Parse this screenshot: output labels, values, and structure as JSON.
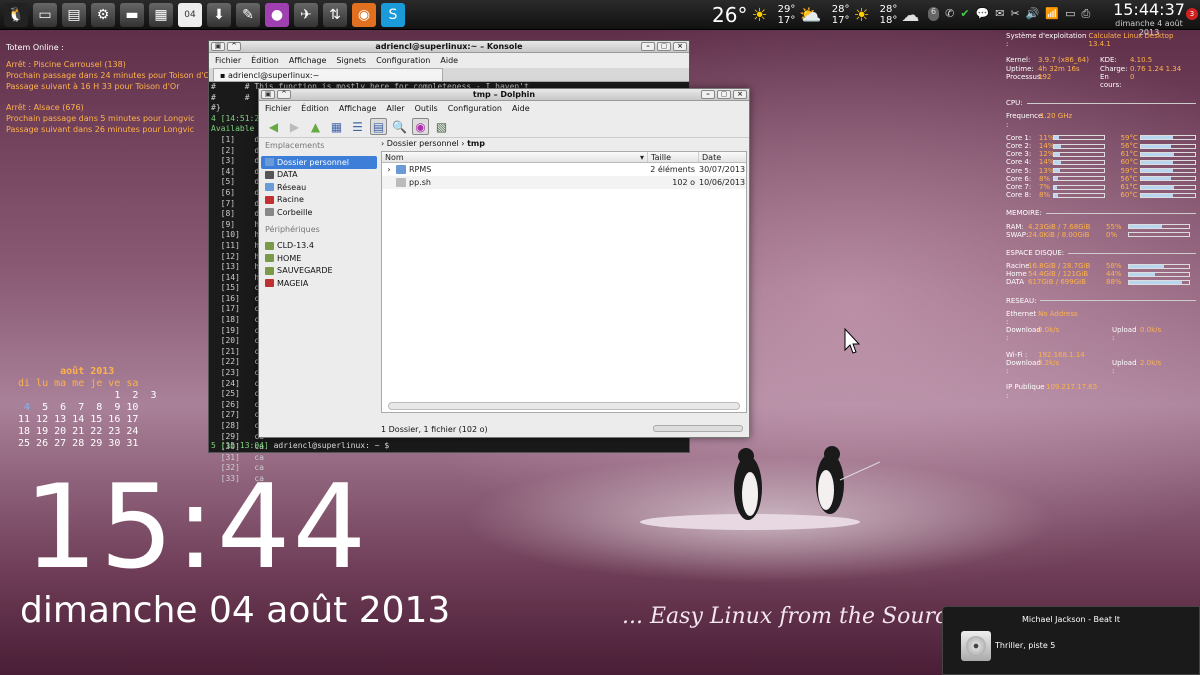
{
  "panel": {
    "launchers": [
      "tux-icon",
      "desktop-icon",
      "server-icon",
      "gear-icon",
      "monitor-icon",
      "calculator-icon",
      "calendar-icon",
      "download-icon",
      "notes-icon",
      "chat-icon",
      "bird-icon",
      "network-icon",
      "firefox-icon",
      "skype-icon"
    ],
    "calendar_day": "04",
    "weather": {
      "now_temp": "26°",
      "d1_high": "29°",
      "d1_low": "17°",
      "d2_high": "28°",
      "d2_low": "17°",
      "d3_high": "28°",
      "d3_low": "18°"
    },
    "tray_badge": "6",
    "clock_time": "15:44:37",
    "clock_date": "dimanche 4 août 2013",
    "notif_count": "3"
  },
  "totem": {
    "title": "Totem Online :",
    "stop1": "Arrêt : Piscine Carrousel  (138)",
    "stop1_l1": "Prochain passage dans 24 minutes pour Toison d'Or",
    "stop1_l2": "Passage suivant à 16 H 33 pour Toison d'Or",
    "stop2": "Arrêt : Alsace  (676)",
    "stop2_l1": "Prochain passage dans 5 minutes pour Longvic",
    "stop2_l2": "Passage suivant dans 26 minutes pour Longvic"
  },
  "calendar": {
    "month": "août 2013",
    "weekdays": "di lu ma me je ve sa",
    "row1": "                1  2  3",
    "row2a": " ",
    "today": "4",
    "row2b": "  5  6  7  8  9 10",
    "row3": "11 12 13 14 15 16 17",
    "row4": "18 19 20 21 22 23 24",
    "row5": "25 26 27 28 29 30 31"
  },
  "desktop": {
    "big_time": "15:44",
    "big_date": "dimanche 04 août 2013",
    "slogan": "... Easy Linux from the Source"
  },
  "sysmon": {
    "os_label": "Système d'exploitation :",
    "os_value": "Calculate Linux Desktop 13.4.1",
    "kernel_l": "Kernel:",
    "kernel_v": "3.9.7 (x86_64)",
    "kde_l": "KDE:",
    "kde_v": "4.10.5",
    "uptime_l": "Uptime:",
    "uptime_v": "4h 32m 16s",
    "charge_l": "Charge:",
    "charge_v": "0.76 1.24 1.34",
    "proc_l": "Processus:",
    "proc_v": "192",
    "encours_l": "En cours:",
    "encours_v": "0",
    "cpu_title": "CPU:",
    "freq_l": "Frequence :",
    "freq_v": "1.20 GHz",
    "cores": [
      {
        "name": "Core 1:",
        "pct": "11%",
        "fill": 0.11,
        "temp": "59°C",
        "tfill": 0.59
      },
      {
        "name": "Core 2:",
        "pct": "14%",
        "fill": 0.14,
        "temp": "56°C",
        "tfill": 0.56
      },
      {
        "name": "Core 3:",
        "pct": "12%",
        "fill": 0.12,
        "temp": "61°C",
        "tfill": 0.61
      },
      {
        "name": "Core 4:",
        "pct": "14%",
        "fill": 0.14,
        "temp": "60°C",
        "tfill": 0.6
      },
      {
        "name": "Core 5:",
        "pct": "13%",
        "fill": 0.13,
        "temp": "59°C",
        "tfill": 0.59
      },
      {
        "name": "Core 6:",
        "pct": "8%",
        "fill": 0.08,
        "temp": "56°C",
        "tfill": 0.56
      },
      {
        "name": "Core 7:",
        "pct": "7%",
        "fill": 0.07,
        "temp": "61°C",
        "tfill": 0.61
      },
      {
        "name": "Core 8:",
        "pct": "8%",
        "fill": 0.08,
        "temp": "60°C",
        "tfill": 0.6
      }
    ],
    "mem_title": "MEMOIRE:",
    "ram_l": "RAM:",
    "ram_v": "4.23GiB / 7.68GiB",
    "ram_p": "55%",
    "ram_f": 0.55,
    "swap_l": "SWAP:",
    "swap_v": "24.0KiB / 8.00GiB",
    "swap_p": "0%",
    "swap_f": 0.0,
    "disk_title": "ESPACE DISQUE:",
    "disks": [
      {
        "name": "Racine",
        "v": "16.8GiB / 28.7GiB",
        "p": "58%",
        "f": 0.58
      },
      {
        "name": "Home",
        "v": "54.4GiB / 121GiB",
        "p": "44%",
        "f": 0.44
      },
      {
        "name": "DATA",
        "v": "617GiB / 699GiB",
        "p": "88%",
        "f": 0.88
      }
    ],
    "net_title": "RESEAU:",
    "eth_l": "Ethernet :",
    "eth_v": "No Address",
    "eth_dl_l": "Download :",
    "eth_dl_v": "0.0k/s",
    "eth_ul_l": "Upload :",
    "eth_ul_v": "0.0k/s",
    "wifi_l": "Wi-Fi :",
    "wifi_v": "192.168.1.14",
    "wifi_dl_l": "Download :",
    "wifi_dl_v": "3.2k/s",
    "wifi_ul_l": "Upload :",
    "wifi_ul_v": "2.0k/s",
    "ip_l": "IP Publique :",
    "ip_v": "109.217.17.65"
  },
  "music": {
    "song": "Michael Jackson - Beat It",
    "album": "Thriller, piste 5"
  },
  "konsole": {
    "title": "adriencl@superlinux:~ – Konsole",
    "menu": [
      "Fichier",
      "Édition",
      "Affichage",
      "Signets",
      "Configuration",
      "Aide"
    ],
    "tab": "adriencl@superlinux:~",
    "line_a": "#      # This function is mostly here for completeness - I haven't",
    "line_b": "#      #",
    "line_c": "#}",
    "line_d": "4 [14:51:2",
    "line_e": "Available",
    "rows": [
      "  [1]    de",
      "  [2]    de",
      "  [3]    de",
      "  [4]    de",
      "  [5]    de",
      "  [6]    de",
      "  [7]    de",
      "  [8]    de",
      "  [9]    ha",
      "  [10]   ha",
      "  [11]   ha",
      "  [12]   ha",
      "  [13]   ha",
      "  [14]   ha",
      "  [15]   ca",
      "  [16]   ca",
      "  [17]   ca",
      "  [18]   ca",
      "  [19]   ca",
      "  [20]   ca",
      "  [21]   ca",
      "  [22]   ca",
      "  [23]   ca",
      "  [24]   ca",
      "  [25]   ca",
      "  [26]   ca",
      "  [27]   ca",
      "  [28]   ca",
      "  [29]   ca",
      "  [30]   ca",
      "  [31]   ca",
      "  [32]   ca",
      "  [33]   ca"
    ],
    "prompt_num": "5 [15:13:04]",
    "prompt_user": " adriencl@superlinux: ~ $"
  },
  "dolphin": {
    "title": "tmp – Dolphin",
    "menu": [
      "Fichier",
      "Édition",
      "Affichage",
      "Aller",
      "Outils",
      "Configuration",
      "Aide"
    ],
    "places_head": "Emplacements",
    "places": [
      {
        "label": "Dossier personnel",
        "sel": true,
        "color": "#6b9bd6"
      },
      {
        "label": "DATA",
        "sel": false,
        "color": "#555"
      },
      {
        "label": "Réseau",
        "sel": false,
        "color": "#6b9bd6"
      },
      {
        "label": "Racine",
        "sel": false,
        "color": "#c03030"
      },
      {
        "label": "Corbeille",
        "sel": false,
        "color": "#888"
      }
    ],
    "devices_head": "Périphériques",
    "devices": [
      {
        "label": "CLD-13.4",
        "color": "#7a9a4a"
      },
      {
        "label": "HOME",
        "color": "#7a9a4a"
      },
      {
        "label": "SAUVEGARDE",
        "color": "#7a9a4a"
      },
      {
        "label": "MAGEIA",
        "color": "#c03030"
      }
    ],
    "crumb_home": "Dossier personnel",
    "crumb_cur": "tmp",
    "col_name": "Nom",
    "col_size": "Taille",
    "col_date": "Date",
    "files": [
      {
        "name": "RPMS",
        "size": "2 éléments",
        "date": "30/07/2013",
        "icon": "folder-icon"
      },
      {
        "name": "pp.sh",
        "size": "102 o",
        "date": "10/06/2013",
        "icon": "file-icon"
      }
    ],
    "status": "1 Dossier, 1 fichier (102 o)"
  }
}
